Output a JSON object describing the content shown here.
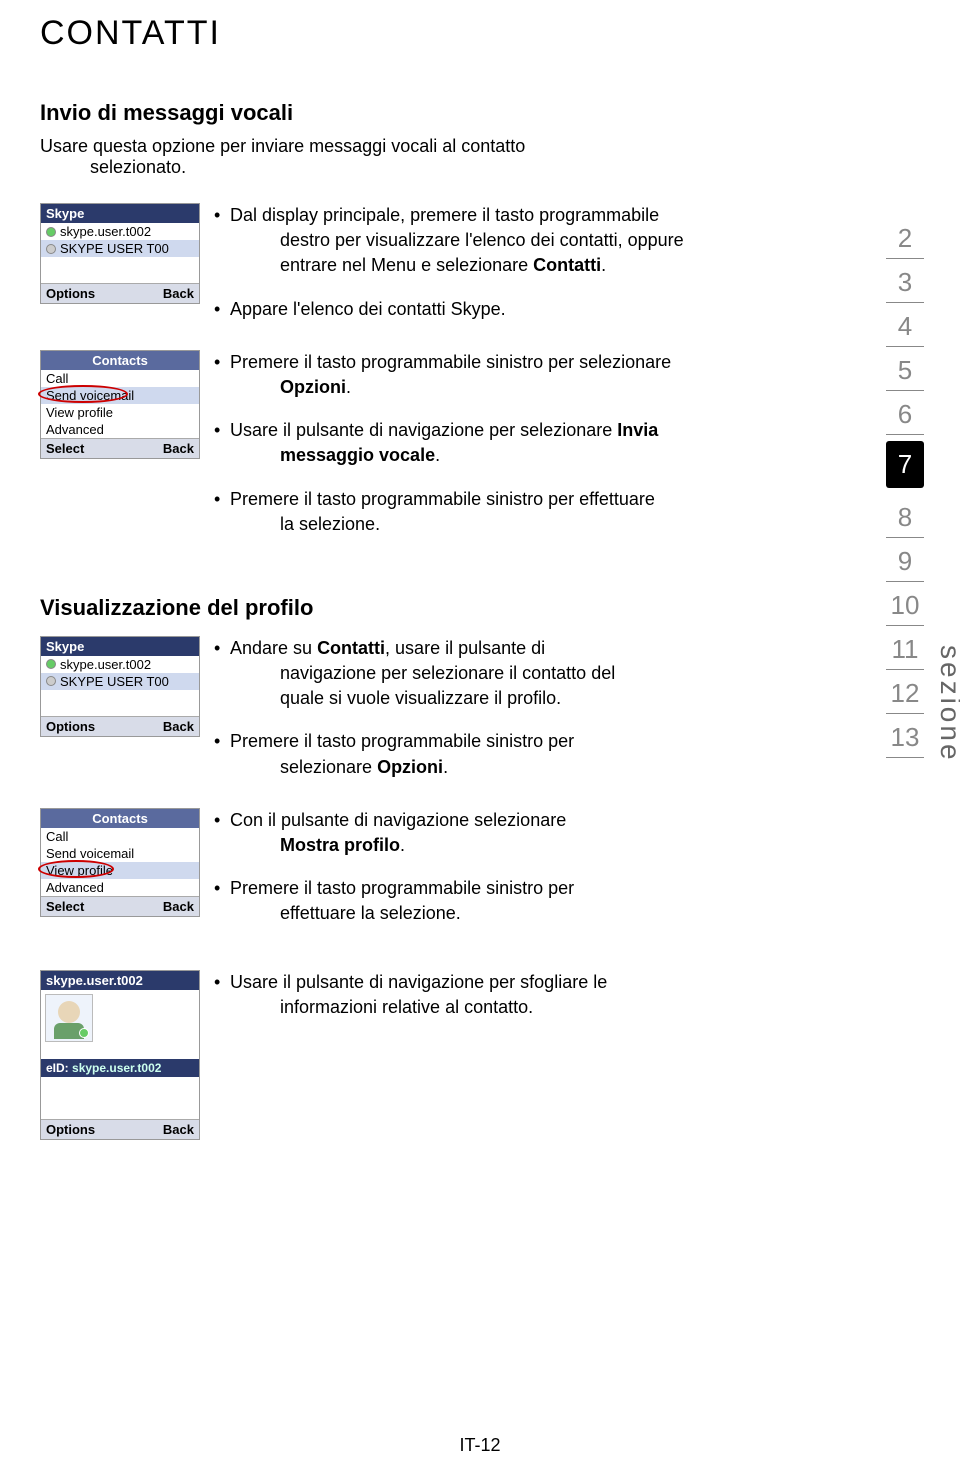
{
  "page": {
    "title": "CONTATTI",
    "footer": "IT-12",
    "vertical_label": "sezione"
  },
  "section1": {
    "subtitle": "Invio di messaggi vocali",
    "intro_line1": "Usare questa opzione per inviare messaggi vocali al contatto",
    "intro_line2": "selezionato.",
    "step1_a": "Dal display principale, premere il tasto programmabile",
    "step1_b": "destro per visualizzare l'elenco dei contatti, oppure",
    "step1_c": "entrare nel Menu e selezionare ",
    "step1_bold": "Contatti",
    "step1_end": ".",
    "step2": "Appare l'elenco dei contatti Skype.",
    "step3_a": "Premere il tasto programmabile sinistro per selezionare",
    "step3_bold": "Opzioni",
    "step3_end": ".",
    "step4_a": "Usare il pulsante di navigazione per selezionare ",
    "step4_bold": "Invia",
    "step4_b": "messaggio vocale",
    "step4_end": ".",
    "step5_a": "Premere il tasto programmabile sinistro per effettuare",
    "step5_b": "la selezione."
  },
  "section2": {
    "subtitle": "Visualizzazione del profilo",
    "step1_a": "Andare su ",
    "step1_bold": "Contatti",
    "step1_b": ", usare il pulsante di",
    "step1_c": "navigazione per selezionare il contatto del",
    "step1_d": "quale si vuole visualizzare il profilo.",
    "step2_a": "Premere il tasto programmabile sinistro per",
    "step2_b": "selezionare ",
    "step2_bold": "Opzioni",
    "step2_end": ".",
    "step3_a": "Con il pulsante di navigazione selezionare",
    "step3_bold": "Mostra profilo",
    "step3_end": ".",
    "step4_a": "Premere il tasto programmabile sinistro per",
    "step4_b": "effettuare la selezione.",
    "step5_a": "Usare il pulsante di navigazione per sfogliare le",
    "step5_b": "informazioni relative al contatto."
  },
  "phone_skype": {
    "title": "Skype",
    "user1": "skype.user.t002",
    "user2": "SKYPE USER T00",
    "left": "Options",
    "right": "Back"
  },
  "phone_contacts": {
    "title": "Contacts",
    "call": "Call",
    "send": "Send voicemail",
    "view": "View profile",
    "adv": "Advanced",
    "left": "Select",
    "right": "Back"
  },
  "phone_profile": {
    "title": "skype.user.t002",
    "eid_label": "eID:",
    "eid_val": "skype.user.t002",
    "left": "Options",
    "right": "Back"
  },
  "tabs": [
    "2",
    "3",
    "4",
    "5",
    "6",
    "7",
    "8",
    "9",
    "10",
    "11",
    "12",
    "13"
  ],
  "active_tab": "7"
}
